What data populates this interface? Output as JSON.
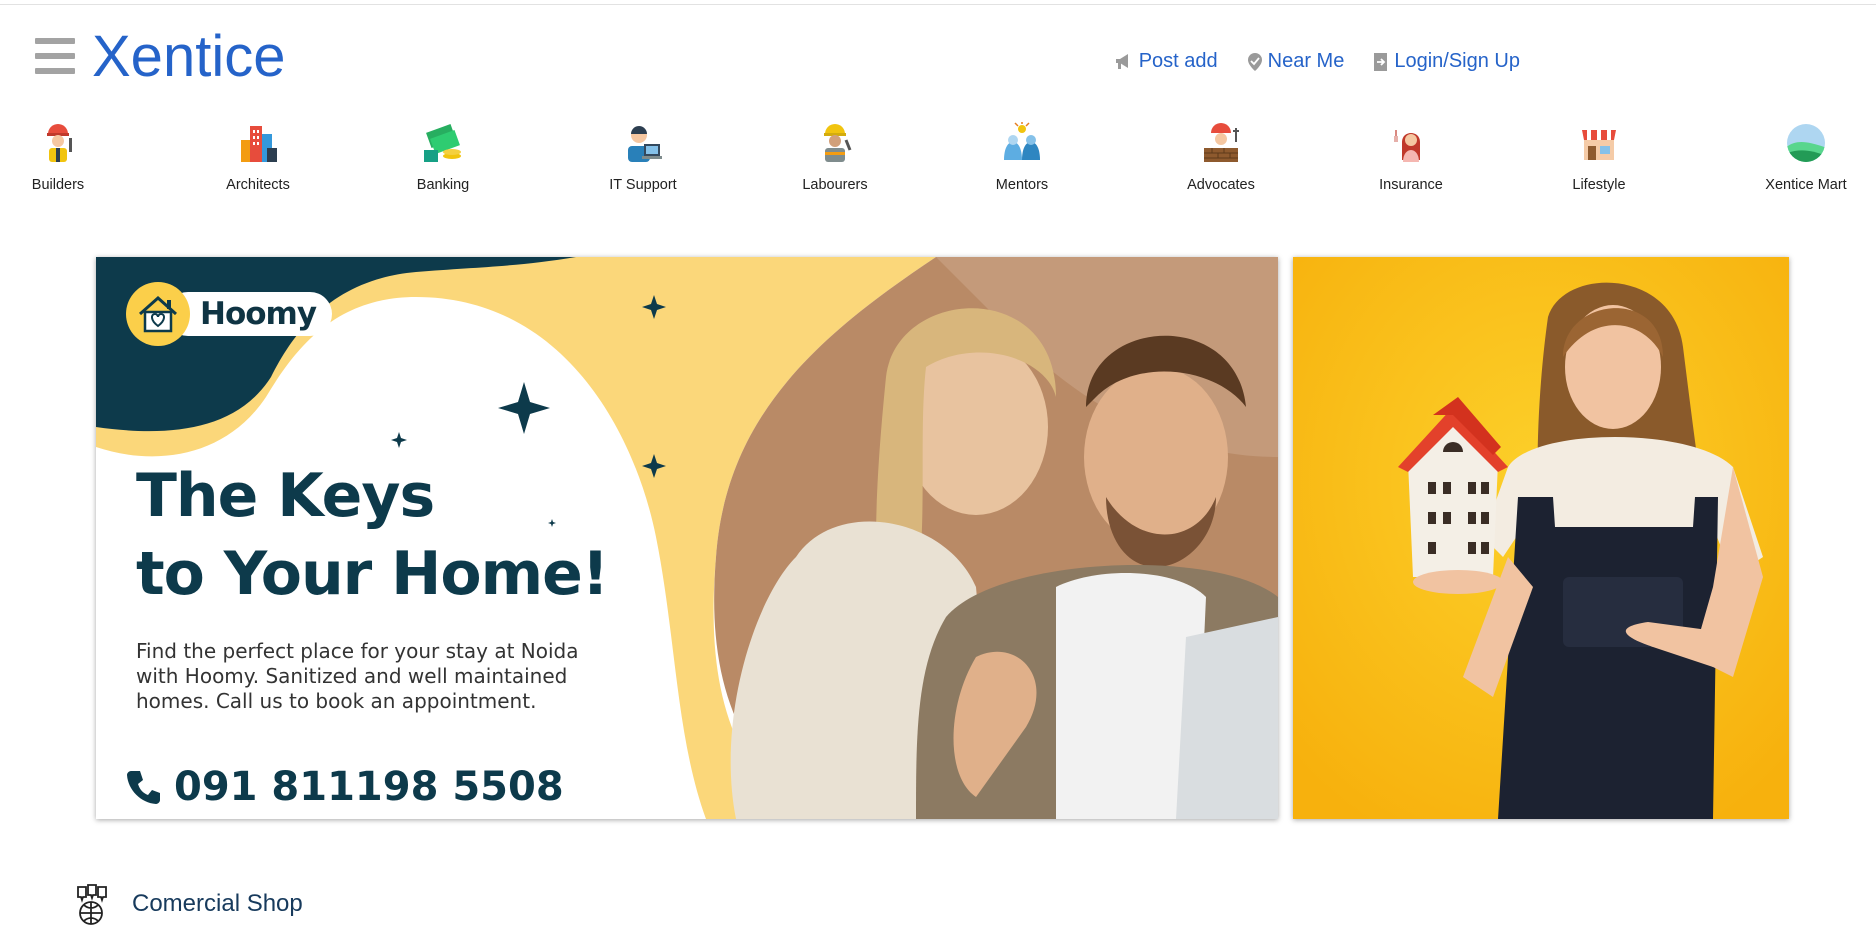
{
  "header": {
    "brand": "Xentice",
    "nav": [
      {
        "label": "Post add",
        "icon": "megaphone-icon"
      },
      {
        "label": "Near Me",
        "icon": "location-pin-icon"
      },
      {
        "label": "Login/Sign Up",
        "icon": "login-icon"
      }
    ]
  },
  "categories": [
    {
      "label": "Builders",
      "icon": "builder-icon"
    },
    {
      "label": "Architects",
      "icon": "buildings-icon"
    },
    {
      "label": "Banking",
      "icon": "money-icon"
    },
    {
      "label": "IT Support",
      "icon": "it-support-icon"
    },
    {
      "label": "Labourers",
      "icon": "labourer-icon"
    },
    {
      "label": "Mentors",
      "icon": "mentors-icon"
    },
    {
      "label": "Advocates",
      "icon": "advocate-icon"
    },
    {
      "label": "Insurance",
      "icon": "insurance-icon"
    },
    {
      "label": "Lifestyle",
      "icon": "shop-icon"
    },
    {
      "label": "Xentice Mart",
      "icon": "landscape-icon"
    }
  ],
  "banner": {
    "logo_text": "Hoomy",
    "headline_line1": "The Keys",
    "headline_line2": "to Your Home!",
    "description": "Find the perfect place for your  stay at Noida with Hoomy. Sanitized  and well maintained homes. Call us to book an appointment.",
    "phone": "091 811198 5508"
  },
  "section": {
    "title": "Comercial Shop",
    "icon": "commercial-map-icon"
  },
  "colors": {
    "brand": "#2563c9",
    "banner_dark": "#0d3a4b",
    "banner_yellow": "#fbd77a",
    "side_banner_yellow": "#fcbf16"
  }
}
